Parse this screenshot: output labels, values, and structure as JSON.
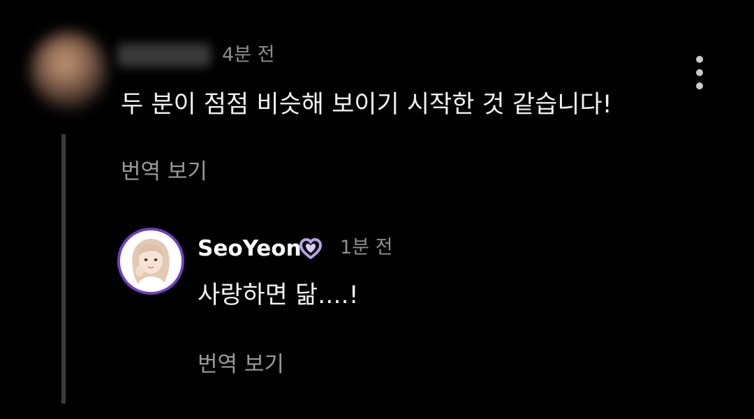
{
  "comment": {
    "username": "",
    "timestamp": "4분 전",
    "text": "두 분이 점점 비슷해 보이기 시작한 것 같습니다!",
    "translate_label": "번역 보기"
  },
  "reply": {
    "username": "SeoYeon",
    "badge_icon": "purple-heart-icon",
    "timestamp": "1분 전",
    "text": "사랑하면 닮....!",
    "translate_label": "번역 보기"
  },
  "colors": {
    "background": "#000000",
    "accent": "#6f3fc2",
    "badge": "#b8a3ea",
    "muted_text": "#8f8f8f"
  }
}
